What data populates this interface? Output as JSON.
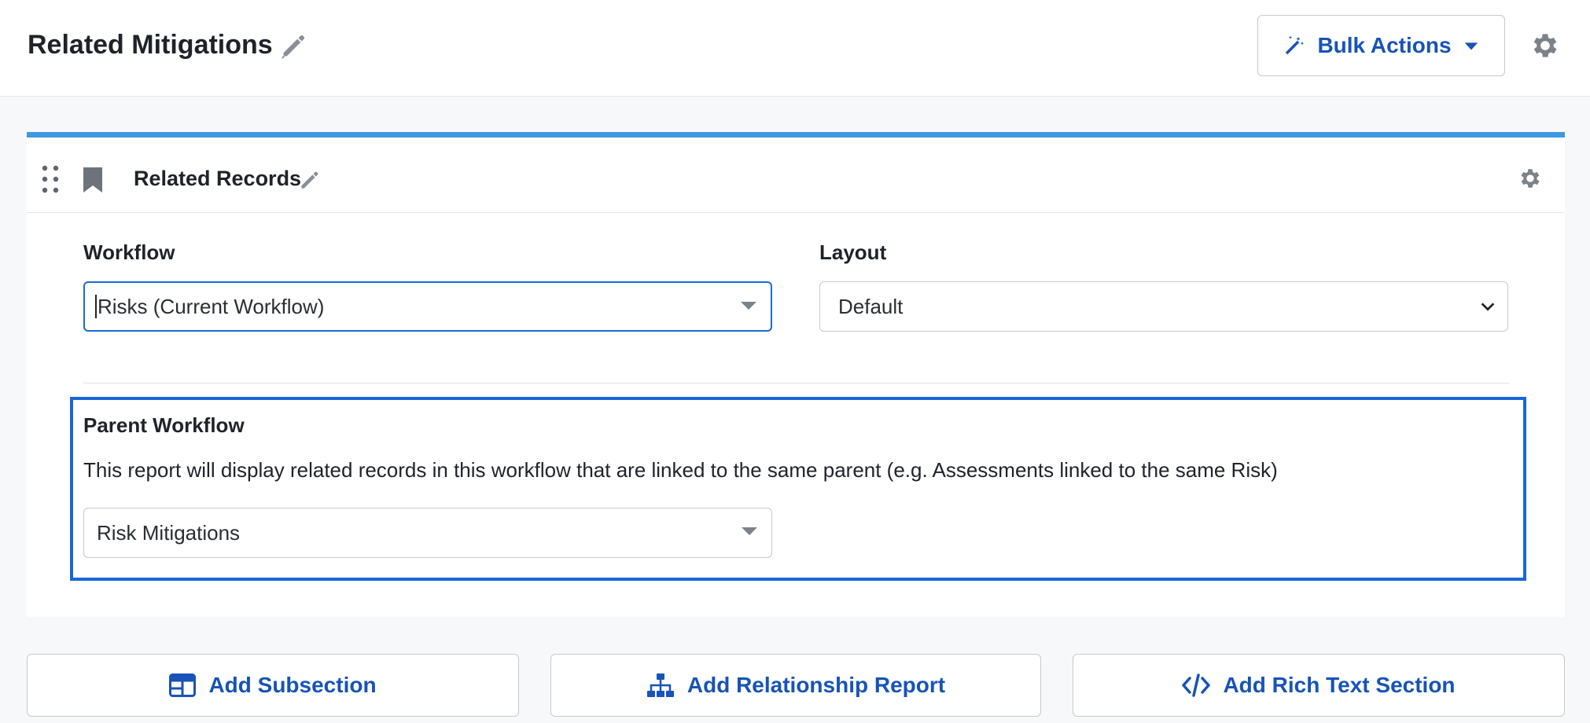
{
  "header": {
    "title": "Related Mitigations",
    "bulk_actions_label": "Bulk Actions"
  },
  "card": {
    "title": "Related Records",
    "accent_color": "#4098e0"
  },
  "fields": {
    "workflow": {
      "label": "Workflow",
      "value": "Risks (Current Workflow)"
    },
    "layout": {
      "label": "Layout",
      "value": "Default"
    }
  },
  "parent_workflow": {
    "label": "Parent Workflow",
    "description": "This report will display related records in this workflow that are linked to the same parent (e.g. Assessments linked to the same Risk)",
    "value": "Risk Mitigations"
  },
  "actions": {
    "add_subsection": "Add Subsection",
    "add_relationship_report": "Add Relationship Report",
    "add_rich_text_section": "Add Rich Text Section"
  },
  "icons": {
    "title_edit": "pencil-icon",
    "bulk": "magic-wand-icon",
    "bulk_caret": "caret-down-icon",
    "settings": "gear-icon",
    "drag": "drag-handle-icon",
    "bookmark": "bookmark-icon",
    "subsection": "layout-grid-icon",
    "relationship": "sitemap-icon",
    "rich_text": "code-icon"
  },
  "colors": {
    "brand_blue": "#1753b8",
    "focus_blue": "#1b6ad8",
    "icon_gray": "#7c8289"
  }
}
